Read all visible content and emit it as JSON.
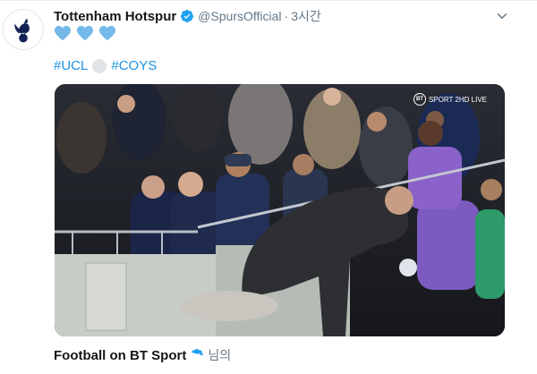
{
  "tweet": {
    "author": {
      "display_name": "Tottenham Hotspur",
      "handle": "@SpursOfficial",
      "verified": true,
      "avatar_icon": "spurs-cockerel-icon"
    },
    "time": "3시간",
    "separator": "·",
    "hearts": [
      "💙",
      "💙",
      "💙"
    ],
    "heart_color": "#74b9e8",
    "hashtags": [
      "#UCL",
      "#COYS"
    ],
    "hashtag_color": "#1b95e0",
    "media": {
      "type": "video",
      "watermark": "SPORT 2HD LIVE",
      "watermark_logo": "BT"
    },
    "attribution": {
      "name": "Football on BT Sport",
      "verified": true,
      "suffix": "님의"
    }
  },
  "colors": {
    "verified_blue": "#1da1f2",
    "secondary_text": "#657786"
  }
}
